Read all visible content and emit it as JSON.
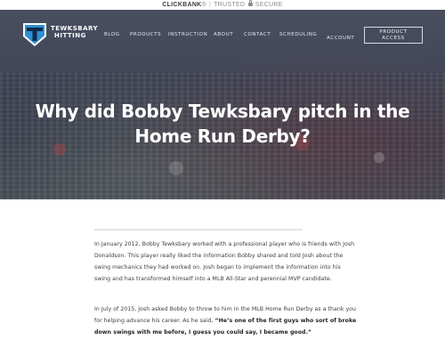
{
  "trustbar": {
    "brand": "CLICKBANK",
    "reg": "®",
    "separator": "|",
    "trusted": "TRUSTED",
    "secure": "SECURE"
  },
  "brand": {
    "line1": "TEWKSBARY",
    "line2": "HITTING",
    "logo_colors": {
      "primary": "#2f8fd0",
      "dark": "#0f2a4a",
      "white": "#ffffff"
    }
  },
  "nav": {
    "items": [
      {
        "label": "BLOG"
      },
      {
        "label": "PRODUCTS"
      },
      {
        "label": "INSTRUCTION"
      },
      {
        "label": "ABOUT"
      },
      {
        "label": "CONTACT"
      },
      {
        "label": "SCHEDULING"
      },
      {
        "label": "ACCOUNT"
      }
    ],
    "cta_line1": "PRODUCT",
    "cta_line2": "ACCESS"
  },
  "hero": {
    "title_line1": "Why did Bobby Tewksbary pitch in the",
    "title_line2": "Home Run Derby?"
  },
  "article": {
    "p1": "In January 2012, Bobby Tewksbary worked with a professional player who is friends with Josh Donaldson. This player really liked the information Bobby shared and told Josh about the swing mechanics they had worked on. Josh began to implement the information into his swing and has transformed himself into a MLB All-Star and perennial MVP candidate.",
    "p2_text": "In July of 2015, Josh asked Bobby to throw to him in the MLB Home Run Derby as a thank you for helping advance his career. As he said, ",
    "p2_quote": "“He’s one of the first guys who sort of broke down swings with me before, I guess you could say, I became good.”"
  },
  "colors": {
    "hero_overlay": "#3f4556",
    "text": "#3c3c3c",
    "accent": "#2f8fd0"
  }
}
